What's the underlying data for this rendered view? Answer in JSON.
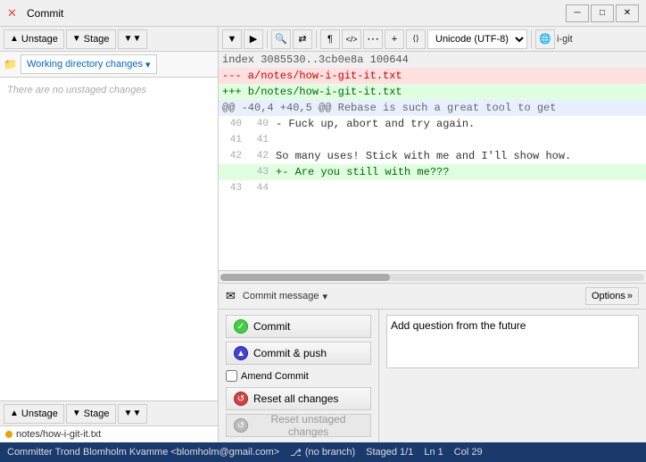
{
  "titlebar": {
    "title": "Commit",
    "icon": "✕",
    "minimize": "─",
    "maximize": "□",
    "close": "✕"
  },
  "left_toolbar": {
    "unstage_label": "Unstage",
    "stage_label": "Stage",
    "working_dir_label": "Working directory changes",
    "dropdown_arrow": "▾"
  },
  "unstaged": {
    "empty_message": "There are no unstaged changes"
  },
  "staged": {
    "files": [
      {
        "name": "notes/how-i-git-it.txt"
      }
    ]
  },
  "diff_toolbar": {
    "nav_left": "◀",
    "nav_right": "▶",
    "search": "🔍",
    "wrap": "↵",
    "more_options": "⋯",
    "paragraph": "¶",
    "html_tag": "</>",
    "encoding": "Unicode (UTF-8)",
    "globe": "🌐",
    "extra": "i-git"
  },
  "diff": {
    "header_line": "index 3085530..3cb0e8a 100644",
    "file_a": "--- a/notes/how-i-git-it.txt",
    "file_b": "+++ b/notes/how-i-git-it.txt",
    "hunk": "@@ -40,4 +40,5 @@ Rebase is such a great tool to get",
    "lines": [
      {
        "num_left": "40",
        "num_right": "40",
        "type": "context",
        "content": "- Fuck up, abort and try again."
      },
      {
        "num_left": "41",
        "num_right": "41",
        "type": "context",
        "content": ""
      },
      {
        "num_left": "42",
        "num_right": "42",
        "type": "context",
        "content": "So many uses! Stick with me and I'll show how."
      },
      {
        "num_left": "",
        "num_right": "43",
        "type": "added",
        "content": "+- Are you still with me???"
      },
      {
        "num_left": "43",
        "num_right": "44",
        "type": "context",
        "content": ""
      }
    ]
  },
  "commit_panel": {
    "commit_msg_icon": "✉",
    "commit_msg_label": "Commit message",
    "commit_msg_dropdown": "▾",
    "options_label": "Options",
    "options_arrow": "»",
    "commit_button": "Commit",
    "commit_push_button": "Commit & push",
    "amend_label": "Amend Commit",
    "reset_all_label": "Reset all changes",
    "reset_unstaged_label": "Reset unstaged changes",
    "message_value": "Add question from the future"
  },
  "statusbar": {
    "committer": "Committer Trond Blomholm Kvamme <blomholm@gmail.com>",
    "branch_icon": "⎇",
    "branch": "(no branch)",
    "staged": "Staged 1/1",
    "ln": "Ln  1",
    "col": "Col 29"
  }
}
